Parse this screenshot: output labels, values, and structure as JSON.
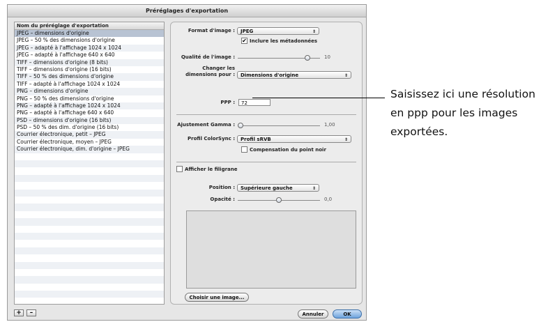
{
  "window": {
    "title": "Préréglages d'exportation"
  },
  "list": {
    "header": "Nom du préréglage d'exportation",
    "items": [
      "JPEG – dimensions d'origine",
      "JPEG – 50 % des dimensions d'origine",
      "JPEG – adapté à l'affichage 1024 x 1024",
      "JPEG – adapté à l'affichage 640 x 640",
      "TIFF – dimensions d'origine (8 bits)",
      "TIFF – dimensions d'origine (16 bits)",
      "TIFF – 50 % des dimensions d'origine",
      "TIFF – adapté à l'affichage 1024 x 1024",
      "PNG – dimensions d'origine",
      "PNG – 50 % des dimensions d'origine",
      "PNG – adapté à l'affichage 1024 x 1024",
      "PNG – adapté à l'affichage 640 x 640",
      "PSD – dimensions d'origine (16 bits)",
      "PSD – 50 % des dim. d'origine (16 bits)",
      "Courrier électronique, petit – JPEG",
      "Courrier électronique, moyen – JPEG",
      "Courrier électronique, dim. d'origine – JPEG"
    ],
    "selected_index": 0,
    "add_label": "+",
    "remove_label": "–"
  },
  "settings": {
    "format_label": "Format d'image :",
    "format_value": "JPEG",
    "include_metadata_label": "Inclure les métadonnées",
    "include_metadata_checked": true,
    "quality_label": "Qualité de l'image :",
    "quality_value": "10",
    "resize_label_line1": "Changer les",
    "resize_label_line2": "dimensions pour :",
    "resize_value": "Dimensions d'origine",
    "dpi_label": "PPP :",
    "dpi_value": "72",
    "gamma_label": "Ajustement Gamma :",
    "gamma_value": "1,00",
    "colorsync_label": "Profil ColorSync :",
    "colorsync_value": "Profil sRVB",
    "black_point_label": "Compensation du point noir",
    "watermark_label": "Afficher le filigrane",
    "position_label": "Position :",
    "position_value": "Supérieure gauche",
    "opacity_label": "Opacité :",
    "opacity_value": "0,0",
    "choose_image_label": "Choisir une image..."
  },
  "buttons": {
    "cancel": "Annuler",
    "ok": "OK"
  },
  "callout": {
    "text": "Saisissez ici une résolution en ppp pour les images exportées."
  }
}
